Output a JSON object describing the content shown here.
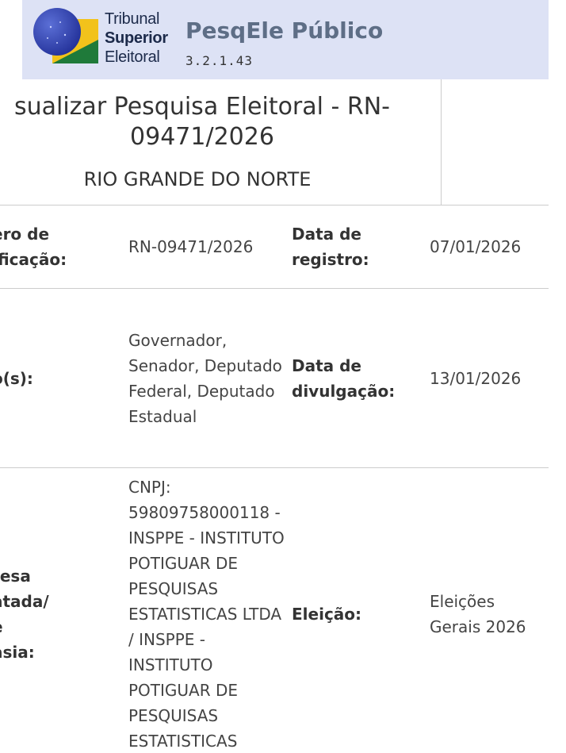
{
  "header": {
    "logo_lines": [
      "Tribunal",
      "Superior",
      "Eleitoral"
    ],
    "app_title": "PesqEle Público",
    "version": "3.2.1.43"
  },
  "page": {
    "title": "sualizar Pesquisa Eleitoral - RN-09471/2026",
    "subtitle": "RIO GRANDE DO NORTE"
  },
  "details": {
    "row1": {
      "label1": "ero de\nificação:",
      "value1": "RN-09471/2026",
      "label2": "Data de registro:",
      "value2": "07/01/2026"
    },
    "row2": {
      "label1": "o(s):",
      "value1": "Governador, Senador, Deputado Federal, Deputado Estadual",
      "label2": "Data de divulgação:",
      "value2": "13/01/2026"
    },
    "row3": {
      "label1": "resa\natada/\ne\nasia:",
      "value1": "CNPJ: 59809758000118 - INSPPE - INSTITUTO POTIGUAR DE PESQUISAS ESTATISTICAS LTDA / INSPPE - INSTITUTO POTIGUAR DE PESQUISAS ESTATISTICAS",
      "label2": "Eleição:",
      "value2": "Eleições Gerais 2026"
    }
  },
  "colors": {
    "header_bg": "#dde2f5",
    "app_title": "#5e6e86",
    "logo_blue": "#2a3a9e",
    "logo_green": "#1f7a3a",
    "logo_yellow": "#f2c21b",
    "border": "#cccccc"
  }
}
